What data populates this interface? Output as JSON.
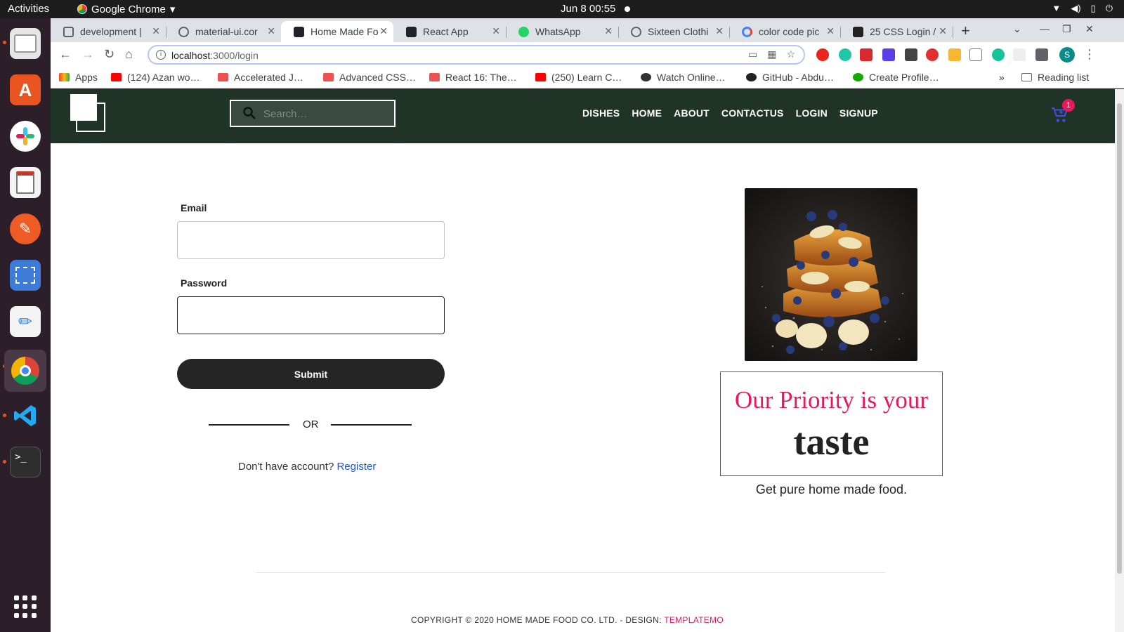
{
  "system_bar": {
    "activities": "Activities",
    "app_name": "Google Chrome",
    "clock": "Jun 8  00:55"
  },
  "dock": {
    "items": [
      "files-icon",
      "software-icon",
      "slack-icon",
      "reader-icon",
      "postman-icon",
      "screenshot-icon",
      "text-editor-icon",
      "chrome-icon",
      "vscode-icon",
      "terminal-icon"
    ],
    "grid": "show-applications-icon"
  },
  "browser": {
    "tabs": [
      {
        "title": "development |",
        "active": false,
        "favicon_color": "#5f6368"
      },
      {
        "title": "material-ui.cor",
        "active": false,
        "favicon_color": "#5f6368"
      },
      {
        "title": "Home Made Fo",
        "active": true,
        "favicon_color": "#20232a"
      },
      {
        "title": "React App",
        "active": false,
        "favicon_color": "#20232a"
      },
      {
        "title": "WhatsApp",
        "active": false,
        "favicon_color": "#25d366"
      },
      {
        "title": "Sixteen Clothi",
        "active": false,
        "favicon_color": "#5f6368"
      },
      {
        "title": "color code pic",
        "active": false,
        "favicon_color": "#4285f4"
      },
      {
        "title": "25 CSS Login /",
        "active": false,
        "favicon_color": "#222222"
      }
    ],
    "url_host": "localhost",
    "url_path": ":3000/login",
    "bookmarks": [
      {
        "label": "Apps",
        "color": "#ea4335"
      },
      {
        "label": "(124) Azan wo…",
        "color": "#ff0000"
      },
      {
        "label": "Accelerated J…",
        "color": "#ec5252"
      },
      {
        "label": "Advanced CSS…",
        "color": "#ec5252"
      },
      {
        "label": "React 16: The…",
        "color": "#ec5252"
      },
      {
        "label": "(250) Learn C…",
        "color": "#ff0000"
      },
      {
        "label": "Watch Online…",
        "color": "#333333"
      },
      {
        "label": "GitHub - Abdu…",
        "color": "#222222"
      },
      {
        "label": "Create Profile…",
        "color": "#14a800"
      }
    ],
    "reading_list": "Reading list",
    "profile_initial": "S"
  },
  "site": {
    "header": {
      "search_placeholder": "Search…",
      "nav": [
        "DISHES",
        "HOME",
        "ABOUT",
        "CONTACTUS",
        "LOGIN",
        "SIGNUP"
      ],
      "cart_count": "1",
      "colors": {
        "header_bg": "#1f3327",
        "accent": "#e8185c"
      }
    },
    "login": {
      "email_label": "Email",
      "email_value": "",
      "password_label": "Password",
      "password_value": "",
      "submit_label": "Submit",
      "or_text": "OR",
      "no_account_text": "Don't have account? ",
      "register_link": "Register"
    },
    "promo": {
      "headline": "Our Priority is your",
      "emphasis": "taste",
      "tagline": "Get pure home made food.",
      "image": "french-toast-with-bananas-and-blueberries"
    },
    "footer": {
      "copyright": "COPYRIGHT © 2020 HOME MADE FOOD CO. LTD. - DESIGN: ",
      "brand": "TEMPLATEMO"
    }
  }
}
